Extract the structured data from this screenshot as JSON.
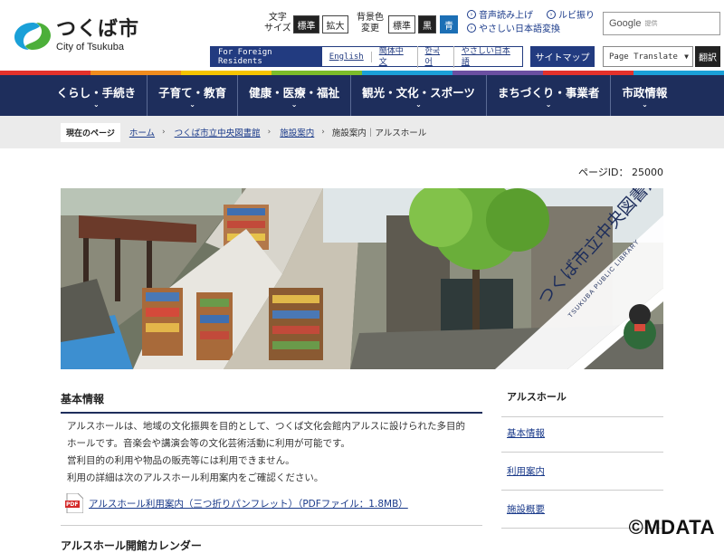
{
  "header": {
    "logo_jp": "つくば市",
    "logo_en": "City of Tsukuba",
    "text_size_label_1": "文字",
    "text_size_label_2": "サイズ",
    "size_standard": "標準",
    "size_large": "拡大",
    "bg_color_label_1": "背景色",
    "bg_color_label_2": "変更",
    "bg_standard": "標準",
    "bg_black": "黒",
    "bg_blue": "青",
    "read_aloud": "音声読み上げ",
    "ruby": "ルビ振り",
    "easy_japanese_convert": "やさしい日本語変換",
    "search_brand": "Google",
    "search_provided": "提供",
    "foreign_label": "For Foreign Residents",
    "languages": [
      "English",
      "簡体中文",
      "한국어",
      "やさしい日本語"
    ],
    "sitemap": "サイトマップ",
    "translate_select": "Page Translate",
    "translate_button": "翻訳"
  },
  "colors": {
    "nav_bg": "#1e2e5c",
    "accent": "#223b80",
    "stripe": [
      "#e4312b",
      "#f08c1e",
      "#f5c400",
      "#7cbd2a",
      "#1aa0d8",
      "#6b4fa1",
      "#e4312b",
      "#1aa0d8"
    ]
  },
  "nav": {
    "items": [
      "くらし・手続き",
      "子育て・教育",
      "健康・医療・福祉",
      "観光・文化・スポーツ",
      "まちづくり・事業者",
      "市政情報"
    ]
  },
  "breadcrumb": {
    "here": "現在のページ",
    "links": [
      "ホーム",
      "つくば市立中央図書館",
      "施設案内"
    ],
    "current": "施設案内｜アルスホール"
  },
  "page_id": "ページID： 25000",
  "hero": {
    "title": "つくば市立中央図書館",
    "subtitle": "TSUKUBA PUBLIC LIBRARY"
  },
  "main": {
    "section_title": "基本情報",
    "paragraphs": [
      "アルスホールは、地域の文化振興を目的として、つくば文化会館内アルスに設けられた多目的",
      "ホールです。音楽会や講演会等の文化芸術活動に利用が可能です。",
      "営利目的の利用や物品の販売等には利用できません。",
      "利用の詳細は次のアルスホール利用案内をご確認ください。"
    ],
    "pdf_icon_text": "PDF",
    "pdf_link": "アルスホール利用案内（三つ折りパンフレット）（PDFファイル：1.8MB）",
    "next_section": "アルスホール開館カレンダー"
  },
  "sidebar": {
    "heading": "アルスホール",
    "items": [
      "基本情報",
      "利用案内",
      "施設概要"
    ]
  },
  "watermark": "©MDATA"
}
